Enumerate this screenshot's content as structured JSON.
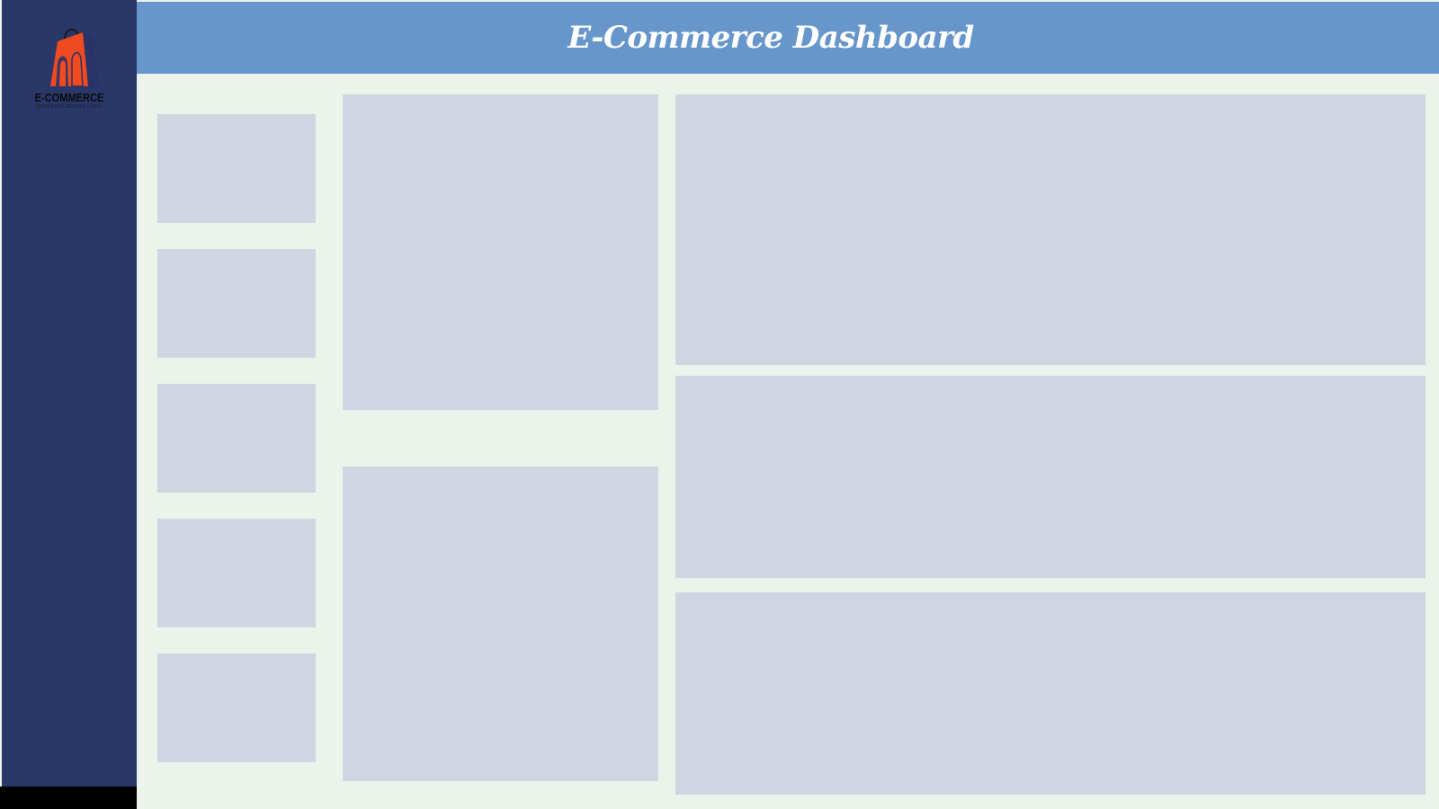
{
  "header": {
    "title": "E-Commerce Dashboard"
  },
  "logo": {
    "name": "E-COMMERCE",
    "tagline": "SHOPPING DESIGN LOGO",
    "icon": "shopping-bag-icon"
  },
  "colors": {
    "sidebar": "#293769",
    "header": "#6796cb",
    "background": "#ebf3ea",
    "panel": "#cfd6e2",
    "logo_accent": "#f04a21"
  }
}
